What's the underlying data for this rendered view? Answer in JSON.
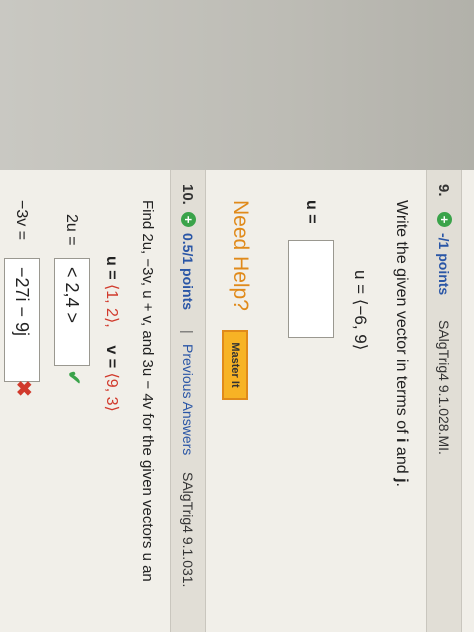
{
  "q9": {
    "number": "9.",
    "plus": "+",
    "points": "-/1 points",
    "source": "SAlgTrig4 9.1.028.MI.",
    "prompt_pre": "Write the given vector in terms of ",
    "prompt_i": "i",
    "prompt_and": " and ",
    "prompt_j": "j",
    "prompt_post": ".",
    "u_def": "u = ⟨−6, 9⟩",
    "u_label": "u =",
    "need_help": "Need Help?",
    "master_it": "Master It"
  },
  "q10": {
    "number": "10.",
    "plus": "+",
    "points": "0.5/1 points",
    "separator": "|",
    "previous_answers": "Previous Answers",
    "source": "SAlgTrig4 9.1.031.",
    "prompt": "Find 2u, −3v, u + v, and 3u − 4v for the given vectors u an",
    "u_label": "u = ",
    "u_value": "⟨1, 2⟩,",
    "v_label": "v = ",
    "v_value": "⟨9, 3⟩",
    "a2u_label": "2u =",
    "a2u_value": "< 2,4 >",
    "a2u_mark": "✔",
    "a3v_label": "−3v =",
    "a3v_value": "−27i − 9j",
    "a3v_mark": "✖"
  }
}
